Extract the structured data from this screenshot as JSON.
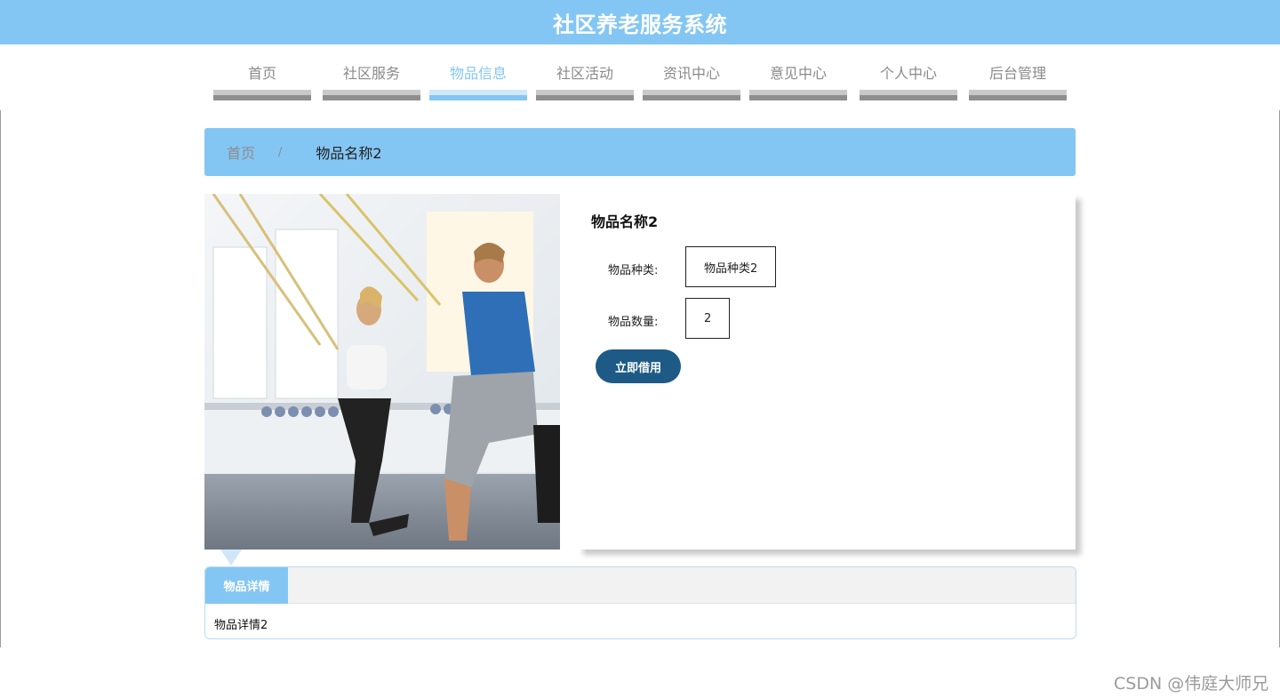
{
  "header": {
    "title": "社区养老服务系统"
  },
  "nav": {
    "items": [
      {
        "label": "首页"
      },
      {
        "label": "社区服务"
      },
      {
        "label": "物品信息"
      },
      {
        "label": "社区活动"
      },
      {
        "label": "资讯中心"
      },
      {
        "label": "意见中心"
      },
      {
        "label": "个人中心"
      },
      {
        "label": "后台管理"
      }
    ],
    "active_index": 2
  },
  "breadcrumb": {
    "home": "首页",
    "separator": "/",
    "current": "物品名称2"
  },
  "product": {
    "title": "物品名称2",
    "category_label": "物品种类:",
    "category_value": "物品种类2",
    "quantity_label": "物品数量:",
    "quantity_value": "2",
    "borrow_button": "立即借用"
  },
  "details": {
    "tab_label": "物品详情",
    "content": "物品详情2"
  },
  "watermark": "CSDN @伟庭大师兄",
  "colors": {
    "accent": "#84c6f3",
    "button": "#1e5a86"
  }
}
